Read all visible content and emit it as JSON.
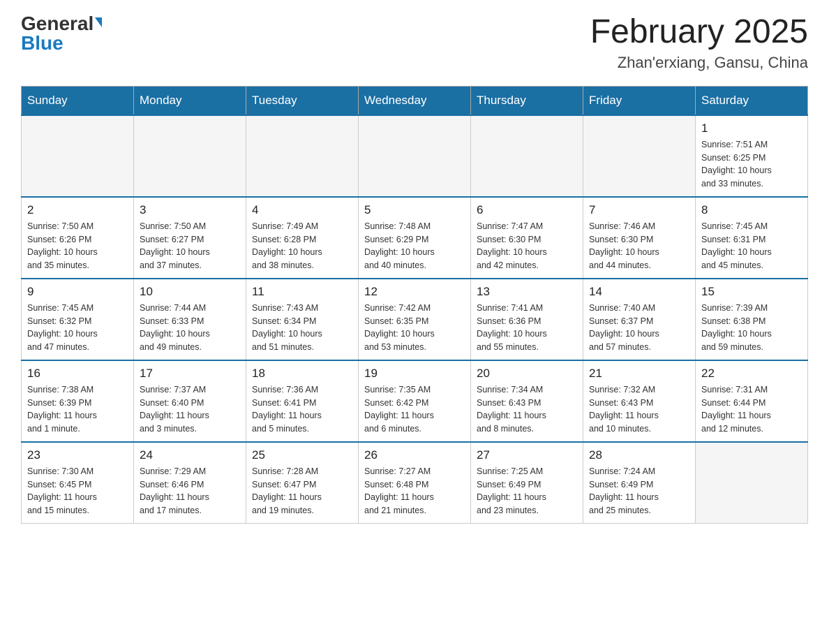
{
  "header": {
    "logo_general": "General",
    "logo_blue": "Blue",
    "month_title": "February 2025",
    "location": "Zhan'erxiang, Gansu, China"
  },
  "weekdays": [
    "Sunday",
    "Monday",
    "Tuesday",
    "Wednesday",
    "Thursday",
    "Friday",
    "Saturday"
  ],
  "weeks": [
    [
      {
        "day": "",
        "info": ""
      },
      {
        "day": "",
        "info": ""
      },
      {
        "day": "",
        "info": ""
      },
      {
        "day": "",
        "info": ""
      },
      {
        "day": "",
        "info": ""
      },
      {
        "day": "",
        "info": ""
      },
      {
        "day": "1",
        "info": "Sunrise: 7:51 AM\nSunset: 6:25 PM\nDaylight: 10 hours\nand 33 minutes."
      }
    ],
    [
      {
        "day": "2",
        "info": "Sunrise: 7:50 AM\nSunset: 6:26 PM\nDaylight: 10 hours\nand 35 minutes."
      },
      {
        "day": "3",
        "info": "Sunrise: 7:50 AM\nSunset: 6:27 PM\nDaylight: 10 hours\nand 37 minutes."
      },
      {
        "day": "4",
        "info": "Sunrise: 7:49 AM\nSunset: 6:28 PM\nDaylight: 10 hours\nand 38 minutes."
      },
      {
        "day": "5",
        "info": "Sunrise: 7:48 AM\nSunset: 6:29 PM\nDaylight: 10 hours\nand 40 minutes."
      },
      {
        "day": "6",
        "info": "Sunrise: 7:47 AM\nSunset: 6:30 PM\nDaylight: 10 hours\nand 42 minutes."
      },
      {
        "day": "7",
        "info": "Sunrise: 7:46 AM\nSunset: 6:30 PM\nDaylight: 10 hours\nand 44 minutes."
      },
      {
        "day": "8",
        "info": "Sunrise: 7:45 AM\nSunset: 6:31 PM\nDaylight: 10 hours\nand 45 minutes."
      }
    ],
    [
      {
        "day": "9",
        "info": "Sunrise: 7:45 AM\nSunset: 6:32 PM\nDaylight: 10 hours\nand 47 minutes."
      },
      {
        "day": "10",
        "info": "Sunrise: 7:44 AM\nSunset: 6:33 PM\nDaylight: 10 hours\nand 49 minutes."
      },
      {
        "day": "11",
        "info": "Sunrise: 7:43 AM\nSunset: 6:34 PM\nDaylight: 10 hours\nand 51 minutes."
      },
      {
        "day": "12",
        "info": "Sunrise: 7:42 AM\nSunset: 6:35 PM\nDaylight: 10 hours\nand 53 minutes."
      },
      {
        "day": "13",
        "info": "Sunrise: 7:41 AM\nSunset: 6:36 PM\nDaylight: 10 hours\nand 55 minutes."
      },
      {
        "day": "14",
        "info": "Sunrise: 7:40 AM\nSunset: 6:37 PM\nDaylight: 10 hours\nand 57 minutes."
      },
      {
        "day": "15",
        "info": "Sunrise: 7:39 AM\nSunset: 6:38 PM\nDaylight: 10 hours\nand 59 minutes."
      }
    ],
    [
      {
        "day": "16",
        "info": "Sunrise: 7:38 AM\nSunset: 6:39 PM\nDaylight: 11 hours\nand 1 minute."
      },
      {
        "day": "17",
        "info": "Sunrise: 7:37 AM\nSunset: 6:40 PM\nDaylight: 11 hours\nand 3 minutes."
      },
      {
        "day": "18",
        "info": "Sunrise: 7:36 AM\nSunset: 6:41 PM\nDaylight: 11 hours\nand 5 minutes."
      },
      {
        "day": "19",
        "info": "Sunrise: 7:35 AM\nSunset: 6:42 PM\nDaylight: 11 hours\nand 6 minutes."
      },
      {
        "day": "20",
        "info": "Sunrise: 7:34 AM\nSunset: 6:43 PM\nDaylight: 11 hours\nand 8 minutes."
      },
      {
        "day": "21",
        "info": "Sunrise: 7:32 AM\nSunset: 6:43 PM\nDaylight: 11 hours\nand 10 minutes."
      },
      {
        "day": "22",
        "info": "Sunrise: 7:31 AM\nSunset: 6:44 PM\nDaylight: 11 hours\nand 12 minutes."
      }
    ],
    [
      {
        "day": "23",
        "info": "Sunrise: 7:30 AM\nSunset: 6:45 PM\nDaylight: 11 hours\nand 15 minutes."
      },
      {
        "day": "24",
        "info": "Sunrise: 7:29 AM\nSunset: 6:46 PM\nDaylight: 11 hours\nand 17 minutes."
      },
      {
        "day": "25",
        "info": "Sunrise: 7:28 AM\nSunset: 6:47 PM\nDaylight: 11 hours\nand 19 minutes."
      },
      {
        "day": "26",
        "info": "Sunrise: 7:27 AM\nSunset: 6:48 PM\nDaylight: 11 hours\nand 21 minutes."
      },
      {
        "day": "27",
        "info": "Sunrise: 7:25 AM\nSunset: 6:49 PM\nDaylight: 11 hours\nand 23 minutes."
      },
      {
        "day": "28",
        "info": "Sunrise: 7:24 AM\nSunset: 6:49 PM\nDaylight: 11 hours\nand 25 minutes."
      },
      {
        "day": "",
        "info": ""
      }
    ]
  ]
}
